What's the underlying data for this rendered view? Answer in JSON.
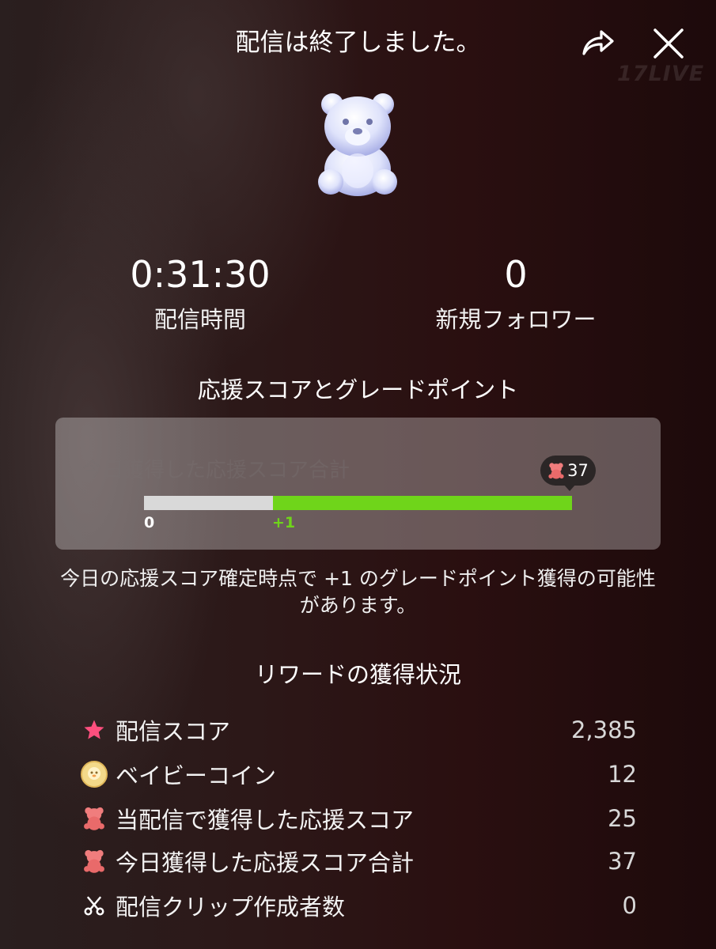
{
  "header": {
    "title": "配信は終了しました。",
    "share_icon": "share-icon",
    "close_icon": "close-icon",
    "watermark": "17LIVE"
  },
  "stats": {
    "duration_value": "0:31:30",
    "duration_label": "配信時間",
    "followers_value": "0",
    "followers_label": "新規フォロワー"
  },
  "support": {
    "title": "応援スコアとグレードポイント",
    "panel_label": "今日獲得した応援スコア合計",
    "tooltip_value": "37",
    "progress_start_label": "0",
    "progress_step_label": "+1",
    "progress_fraction": 1.0,
    "colors": {
      "fill": "#6fd51a",
      "track": "#d9d9d9"
    },
    "note": "今日の応援スコア確定時点で +1 のグレードポイント獲得の可能性があります。"
  },
  "rewards": {
    "title": "リワードの獲得状況",
    "items": [
      {
        "icon": "star-icon",
        "label": "配信スコア",
        "value": "2,385"
      },
      {
        "icon": "baby-coin-icon",
        "label": "ベイビーコイン",
        "value": "12"
      },
      {
        "icon": "gummy-bear-icon",
        "label": "当配信で獲得した応援スコア",
        "value": "25"
      },
      {
        "icon": "gummy-bear-icon",
        "label": "今日獲得した応援スコア合計",
        "value": "37"
      },
      {
        "icon": "scissors-icon",
        "label": "配信クリップ作成者数",
        "value": "0"
      }
    ]
  }
}
